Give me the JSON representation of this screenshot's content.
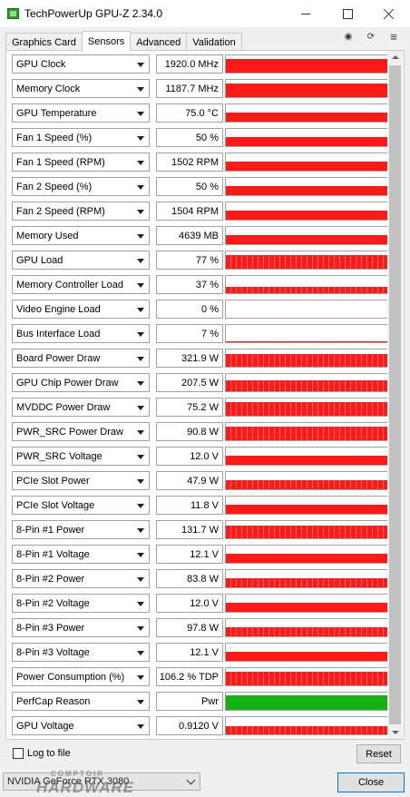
{
  "window": {
    "title": "TechPowerUp GPU-Z 2.34.0",
    "app_icon": "gpu-z-icon",
    "controls": {
      "minimize": "minimize-icon",
      "maximize": "maximize-icon",
      "close": "close-icon"
    }
  },
  "tabs": [
    {
      "label": "Graphics Card",
      "active": false
    },
    {
      "label": "Sensors",
      "active": true
    },
    {
      "label": "Advanced",
      "active": false
    },
    {
      "label": "Validation",
      "active": false
    }
  ],
  "toolbar_icons": [
    "camera-icon",
    "refresh-icon",
    "menu-icon"
  ],
  "colors": {
    "graph_red": "#ff1a1a",
    "graph_green": "#14b214"
  },
  "sensors": [
    {
      "name": "GPU Clock",
      "value": "1920.0 MHz",
      "level": 0.8,
      "color": "red",
      "noisy": false
    },
    {
      "name": "Memory Clock",
      "value": "1187.7 MHz",
      "level": 0.8,
      "color": "red",
      "noisy": false
    },
    {
      "name": "GPU Temperature",
      "value": "75.0 °C",
      "level": 0.52,
      "color": "red",
      "noisy": false
    },
    {
      "name": "Fan 1 Speed (%)",
      "value": "50 %",
      "level": 0.5,
      "color": "red",
      "noisy": false
    },
    {
      "name": "Fan 1 Speed (RPM)",
      "value": "1502 RPM",
      "level": 0.5,
      "color": "red",
      "noisy": false
    },
    {
      "name": "Fan 2 Speed (%)",
      "value": "50 %",
      "level": 0.5,
      "color": "red",
      "noisy": false
    },
    {
      "name": "Fan 2 Speed (RPM)",
      "value": "1504 RPM",
      "level": 0.5,
      "color": "red",
      "noisy": false
    },
    {
      "name": "Memory Used",
      "value": "4639 MB",
      "level": 0.5,
      "color": "red",
      "noisy": false
    },
    {
      "name": "GPU Load",
      "value": "77 %",
      "level": 0.77,
      "color": "red",
      "noisy": true
    },
    {
      "name": "Memory Controller Load",
      "value": "37 %",
      "level": 0.37,
      "color": "red",
      "noisy": true
    },
    {
      "name": "Video Engine Load",
      "value": "0 %",
      "level": 0.0,
      "color": "red",
      "noisy": false
    },
    {
      "name": "Bus Interface Load",
      "value": "7 %",
      "level": 0.07,
      "color": "red",
      "noisy": false
    },
    {
      "name": "Board Power Draw",
      "value": "321.9 W",
      "level": 0.75,
      "color": "red",
      "noisy": true
    },
    {
      "name": "GPU Chip Power Draw",
      "value": "207.5 W",
      "level": 0.65,
      "color": "red",
      "noisy": true
    },
    {
      "name": "MVDDC Power Draw",
      "value": "75.2 W",
      "level": 0.8,
      "color": "red",
      "noisy": true
    },
    {
      "name": "PWR_SRC Power Draw",
      "value": "90.8 W",
      "level": 0.8,
      "color": "red",
      "noisy": true
    },
    {
      "name": "PWR_SRC Voltage",
      "value": "12.0 V",
      "level": 0.5,
      "color": "red",
      "noisy": false
    },
    {
      "name": "PCIe Slot Power",
      "value": "47.9 W",
      "level": 0.55,
      "color": "red",
      "noisy": true
    },
    {
      "name": "PCIe Slot Voltage",
      "value": "11.8 V",
      "level": 0.5,
      "color": "red",
      "noisy": false
    },
    {
      "name": "8-Pin #1 Power",
      "value": "131.7 W",
      "level": 0.75,
      "color": "red",
      "noisy": true
    },
    {
      "name": "8-Pin #1 Voltage",
      "value": "12.1 V",
      "level": 0.5,
      "color": "red",
      "noisy": false
    },
    {
      "name": "8-Pin #2 Power",
      "value": "83.8 W",
      "level": 0.55,
      "color": "red",
      "noisy": true
    },
    {
      "name": "8-Pin #2 Voltage",
      "value": "12.0 V",
      "level": 0.5,
      "color": "red",
      "noisy": false
    },
    {
      "name": "8-Pin #3 Power",
      "value": "97.8 W",
      "level": 0.55,
      "color": "red",
      "noisy": true
    },
    {
      "name": "8-Pin #3 Voltage",
      "value": "12.1 V",
      "level": 0.5,
      "color": "red",
      "noisy": false
    },
    {
      "name": "Power Consumption (%)",
      "value": "106.2 % TDP",
      "level": 0.8,
      "color": "red",
      "noisy": true
    },
    {
      "name": "PerfCap Reason",
      "value": "Pwr",
      "level": 0.85,
      "color": "green",
      "noisy": false
    },
    {
      "name": "GPU Voltage",
      "value": "0.9120 V",
      "level": 0.45,
      "color": "red",
      "noisy": true
    }
  ],
  "footer": {
    "log_to_file": {
      "label": "Log to file",
      "checked": false
    },
    "reset_label": "Reset",
    "gpu_selected": "NVIDIA GeForce RTX 3080",
    "close_label": "Close",
    "watermark_small": "COMPTOIR",
    "watermark_large": "HARDWARE"
  }
}
